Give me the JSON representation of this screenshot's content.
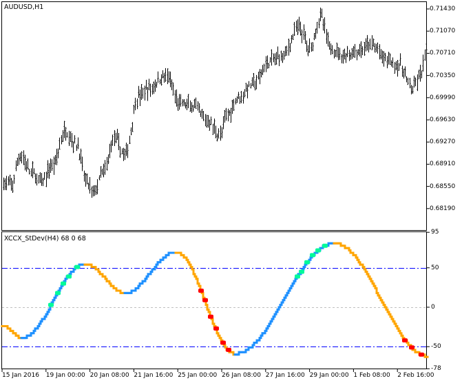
{
  "main_window": {
    "title": "AUDUSD,H1"
  },
  "indicator_window": {
    "title": "XCCX_StDev(H4) 68 0 68"
  },
  "colors": {
    "up": "#1E90FF",
    "down": "#FFA500",
    "strong_up": "#00FA9A",
    "strong_down": "#FF0000",
    "level": "#0000FF",
    "zero": "#C0C0C0",
    "bars": "#000000"
  },
  "chart_data": [
    {
      "type": "line",
      "title": "AUDUSD,H1",
      "series_kind": "bar (OHLC) price path, approximate",
      "yticks": [
        "0.71430",
        "0.71070",
        "0.70710",
        "0.70350",
        "0.69990",
        "0.69630",
        "0.69270",
        "0.68910",
        "0.68550",
        "0.68190"
      ],
      "ylim": [
        0.681,
        0.7153
      ],
      "path": [
        [
          0,
          0.68613
        ],
        [
          5,
          0.68557
        ],
        [
          11,
          0.6906
        ],
        [
          18,
          0.6878
        ],
        [
          25,
          0.68613
        ],
        [
          32,
          0.68892
        ],
        [
          41,
          0.69451
        ],
        [
          48,
          0.69228
        ],
        [
          55,
          0.68613
        ],
        [
          59,
          0.68445
        ],
        [
          66,
          0.6878
        ],
        [
          73,
          0.69339
        ],
        [
          80,
          0.6906
        ],
        [
          89,
          0.7001
        ],
        [
          95,
          0.70122
        ],
        [
          107,
          0.70346
        ],
        [
          116,
          0.69898
        ],
        [
          125,
          0.69842
        ],
        [
          134,
          0.69619
        ],
        [
          143,
          0.69395
        ],
        [
          148,
          0.69731
        ],
        [
          155,
          0.7001
        ],
        [
          166,
          0.70234
        ],
        [
          175,
          0.70569
        ],
        [
          184,
          0.70681
        ],
        [
          195,
          0.71128
        ],
        [
          202,
          0.70793
        ],
        [
          209,
          0.71296
        ],
        [
          216,
          0.70793
        ],
        [
          225,
          0.70681
        ],
        [
          234,
          0.70737
        ],
        [
          243,
          0.70849
        ],
        [
          252,
          0.70625
        ],
        [
          261,
          0.70513
        ],
        [
          270,
          0.70122
        ],
        [
          275,
          0.70346
        ],
        [
          279,
          0.70681
        ]
      ],
      "bar_count": 280
    },
    {
      "type": "line",
      "title": "XCCX_StDev(H4) 68 0 68",
      "yticks": [
        "95",
        "50",
        "0",
        "-50",
        "-78"
      ],
      "ylim": [
        -78,
        95
      ],
      "levels": [
        50,
        0,
        -50
      ],
      "keypoints": [
        [
          0,
          -23
        ],
        [
          14,
          -39
        ],
        [
          60,
          55
        ],
        [
          89,
          18
        ],
        [
          126,
          70
        ],
        [
          169,
          -59
        ],
        [
          241,
          81
        ],
        [
          309,
          -62
        ]
      ],
      "bar_count": 310,
      "markers": [
        {
          "value": 3,
          "color": "strong_up",
          "seg": 2
        },
        {
          "value": 16,
          "color": "strong_up",
          "seg": 2
        },
        {
          "value": 30,
          "color": "strong_up",
          "seg": 2
        },
        {
          "value": 41,
          "color": "strong_up",
          "seg": 2
        },
        {
          "value": 51,
          "color": "strong_up",
          "seg": 2
        },
        {
          "value": 24,
          "color": "strong_down",
          "seg": 5
        },
        {
          "value": 10,
          "color": "strong_down",
          "seg": 5
        },
        {
          "value": -12,
          "color": "strong_down",
          "seg": 5
        },
        {
          "value": -28,
          "color": "strong_down",
          "seg": 5
        },
        {
          "value": -45,
          "color": "strong_down",
          "seg": 5
        },
        {
          "value": -54,
          "color": "strong_down",
          "seg": 5
        },
        {
          "value": 38,
          "color": "strong_up",
          "seg": 6
        },
        {
          "value": 47,
          "color": "strong_up",
          "seg": 6
        },
        {
          "value": 56,
          "color": "strong_up",
          "seg": 6
        },
        {
          "value": 64,
          "color": "strong_up",
          "seg": 6
        },
        {
          "value": 72,
          "color": "strong_up",
          "seg": 6
        },
        {
          "value": 78,
          "color": "strong_up",
          "seg": 6
        },
        {
          "value": -42,
          "color": "strong_down",
          "seg": 7
        },
        {
          "value": -52,
          "color": "strong_down",
          "seg": 7
        },
        {
          "value": -60,
          "color": "strong_down",
          "seg": 7
        }
      ],
      "xticks": [
        "15 Jan 2016",
        "19 Jan 00:00",
        "20 Jan 08:00",
        "21 Jan 16:00",
        "25 Jan 00:00",
        "26 Jan 08:00",
        "27 Jan 16:00",
        "29 Jan 00:00",
        "1 Feb 08:00",
        "2 Feb 16:00"
      ]
    }
  ]
}
